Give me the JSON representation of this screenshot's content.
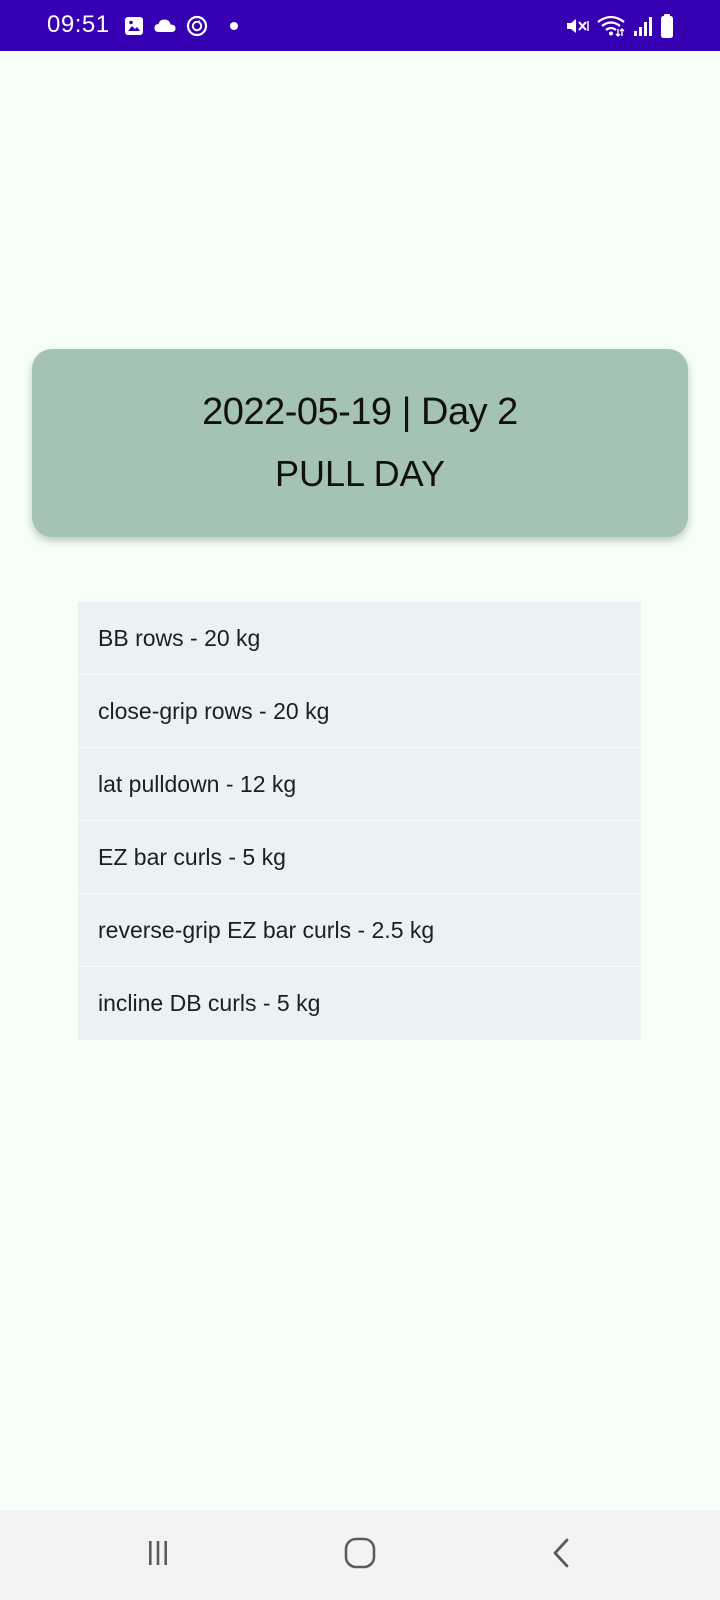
{
  "status_bar": {
    "time": "09:51",
    "color": "#3700b3",
    "left_icons": [
      "gallery-icon",
      "cloud-icon",
      "sync-icon",
      "notification-dot-icon"
    ],
    "right_icons": [
      "mute-vibrate-icon",
      "wifi-icon",
      "signal-icon",
      "battery-icon"
    ]
  },
  "header": {
    "date_line": "2022-05-19 | Day 2",
    "title": "PULL DAY",
    "color": "#a4c3b3"
  },
  "exercises": [
    {
      "text": "BB rows - 20 kg"
    },
    {
      "text": "close-grip rows - 20 kg"
    },
    {
      "text": "lat pulldown - 12 kg"
    },
    {
      "text": "EZ bar curls - 5 kg"
    },
    {
      "text": "reverse-grip EZ bar curls - 2.5 kg"
    },
    {
      "text": "incline DB curls - 5 kg"
    }
  ],
  "nav_bar": {
    "buttons": [
      "recent-apps-icon",
      "home-icon",
      "back-icon"
    ]
  }
}
